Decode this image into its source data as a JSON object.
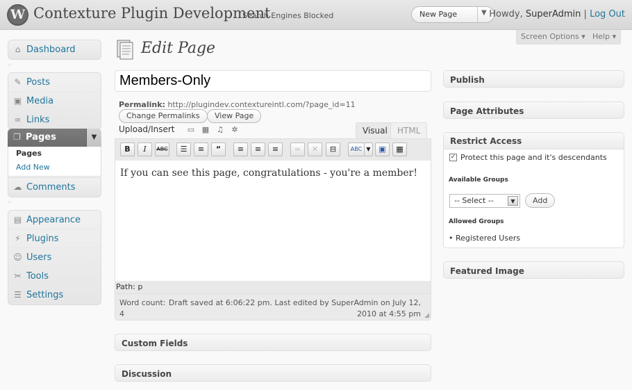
{
  "header": {
    "logo": "W",
    "site_title": "Contexture Plugin Development",
    "site_note": "Search Engines Blocked",
    "fav_action": "New Page",
    "howdy": "Howdy,",
    "username": "SuperAdmin",
    "separator": "|",
    "logout": "Log Out"
  },
  "screen_tabs": {
    "screen_options": "Screen Options",
    "help": "Help"
  },
  "sidebar": {
    "group1": [
      {
        "label": "Dashboard",
        "icon": "house-icon"
      }
    ],
    "group2": [
      {
        "label": "Posts",
        "icon": "pushpin-icon"
      },
      {
        "label": "Media",
        "icon": "media-icon"
      },
      {
        "label": "Links",
        "icon": "link-icon"
      }
    ],
    "pages_label": "Pages",
    "pages_sub": [
      "Pages",
      "Add New"
    ],
    "comments": "Comments",
    "group3": [
      {
        "label": "Appearance",
        "icon": "appearance-icon"
      },
      {
        "label": "Plugins",
        "icon": "plugin-icon"
      },
      {
        "label": "Users",
        "icon": "users-icon"
      },
      {
        "label": "Tools",
        "icon": "tools-icon"
      },
      {
        "label": "Settings",
        "icon": "settings-icon"
      }
    ]
  },
  "page": {
    "title": "Edit Page",
    "post_title": "Members-Only",
    "permalink_label": "Permalink:",
    "permalink_url": "http://plugindev.contextureintl.com/?page_id=11",
    "change_permalinks": "Change Permalinks",
    "view_page": "View Page",
    "upload_insert": "Upload/Insert",
    "tab_visual": "Visual",
    "tab_html": "HTML",
    "content": "If you can see this page, congratulations - you're a member!",
    "path": "Path: p",
    "word_count_label": "Word count:",
    "word_count": "4",
    "draft_status_line1": "Draft saved at 6:06:22 pm. Last edited by SuperAdmin on July 12,",
    "draft_status_line2": "2010 at 4:55 pm"
  },
  "metaboxes": {
    "custom_fields": "Custom Fields",
    "discussion": "Discussion",
    "publish": "Publish",
    "page_attributes": "Page Attributes",
    "featured_image": "Featured Image"
  },
  "restrict": {
    "title": "Restrict Access",
    "checkbox_label": "Protect this page and it's descendants",
    "available_groups": "Available Groups",
    "select_value": "-- Select --",
    "add_button": "Add",
    "allowed_groups": "Allowed Groups",
    "allowed_items": [
      "Registered Users"
    ]
  },
  "colors": {
    "link": "#21759b",
    "header_bg": "#d9d9d9",
    "active_menu": "#737373"
  }
}
